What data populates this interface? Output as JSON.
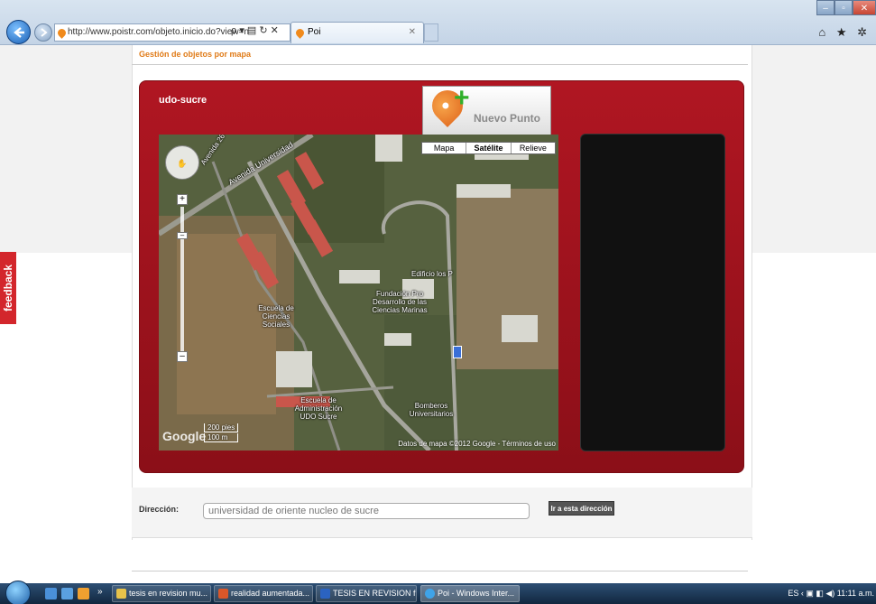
{
  "browser": {
    "url": "http://www.poistr.com/objeto.inicio.do?view=n",
    "url_icons": "ρ ▾ ▤ ↻ ✕",
    "tab_title": "Poi",
    "tab_close": "✕",
    "window_min": "–",
    "window_max": "▫",
    "window_close": "✕",
    "tool_icons": "⌂ ★ ✲"
  },
  "page": {
    "section_title": "Gestión de objetos por mapa",
    "feedback_label": "feedback"
  },
  "panel": {
    "name": "udo-sucre",
    "new_point_label": "Nuevo Punto",
    "new_point_plus": "+",
    "map_types": [
      "Mapa",
      "Satélite",
      "Relieve"
    ],
    "active_map_type": "Satélite"
  },
  "map": {
    "nav_icon": "✋",
    "zoom_in": "+",
    "zoom_out": "–",
    "zoom_knob": "–",
    "labels": {
      "road_1": "Avenida Universidad",
      "road_2": "Avenida 26",
      "edificio": "Edificio los P",
      "fundacion": "Fundación Pro Desarrollo de las Ciencias Marinas",
      "escuela_sociales": "Escuela de Ciencias Sociales",
      "escuela_admin": "Escuela de Administración UDO Sucre",
      "bomberos": "Bomberos Universitarios"
    },
    "scale_ft": "200 pies",
    "scale_m": "100 m",
    "logo": "Google",
    "copyright": "Datos de mapa ©2012 Google - Términos de uso"
  },
  "address": {
    "label": "Dirección:",
    "value": "universidad de oriente nucleo de sucre",
    "button": "Ir a esta dirección"
  },
  "taskbar": {
    "chevron": "»",
    "items": [
      "tesis en revision mu...",
      "realidad aumentada...",
      "TESIS EN REVISION f...",
      "Poi - Windows Inter..."
    ],
    "tray": "ES  ‹  ▣  ◧  ◀)  11:11 a.m."
  },
  "colors": {
    "panel_red": "#a3131e",
    "title_orange": "#e07b18",
    "plus_green": "#2fb02a"
  }
}
